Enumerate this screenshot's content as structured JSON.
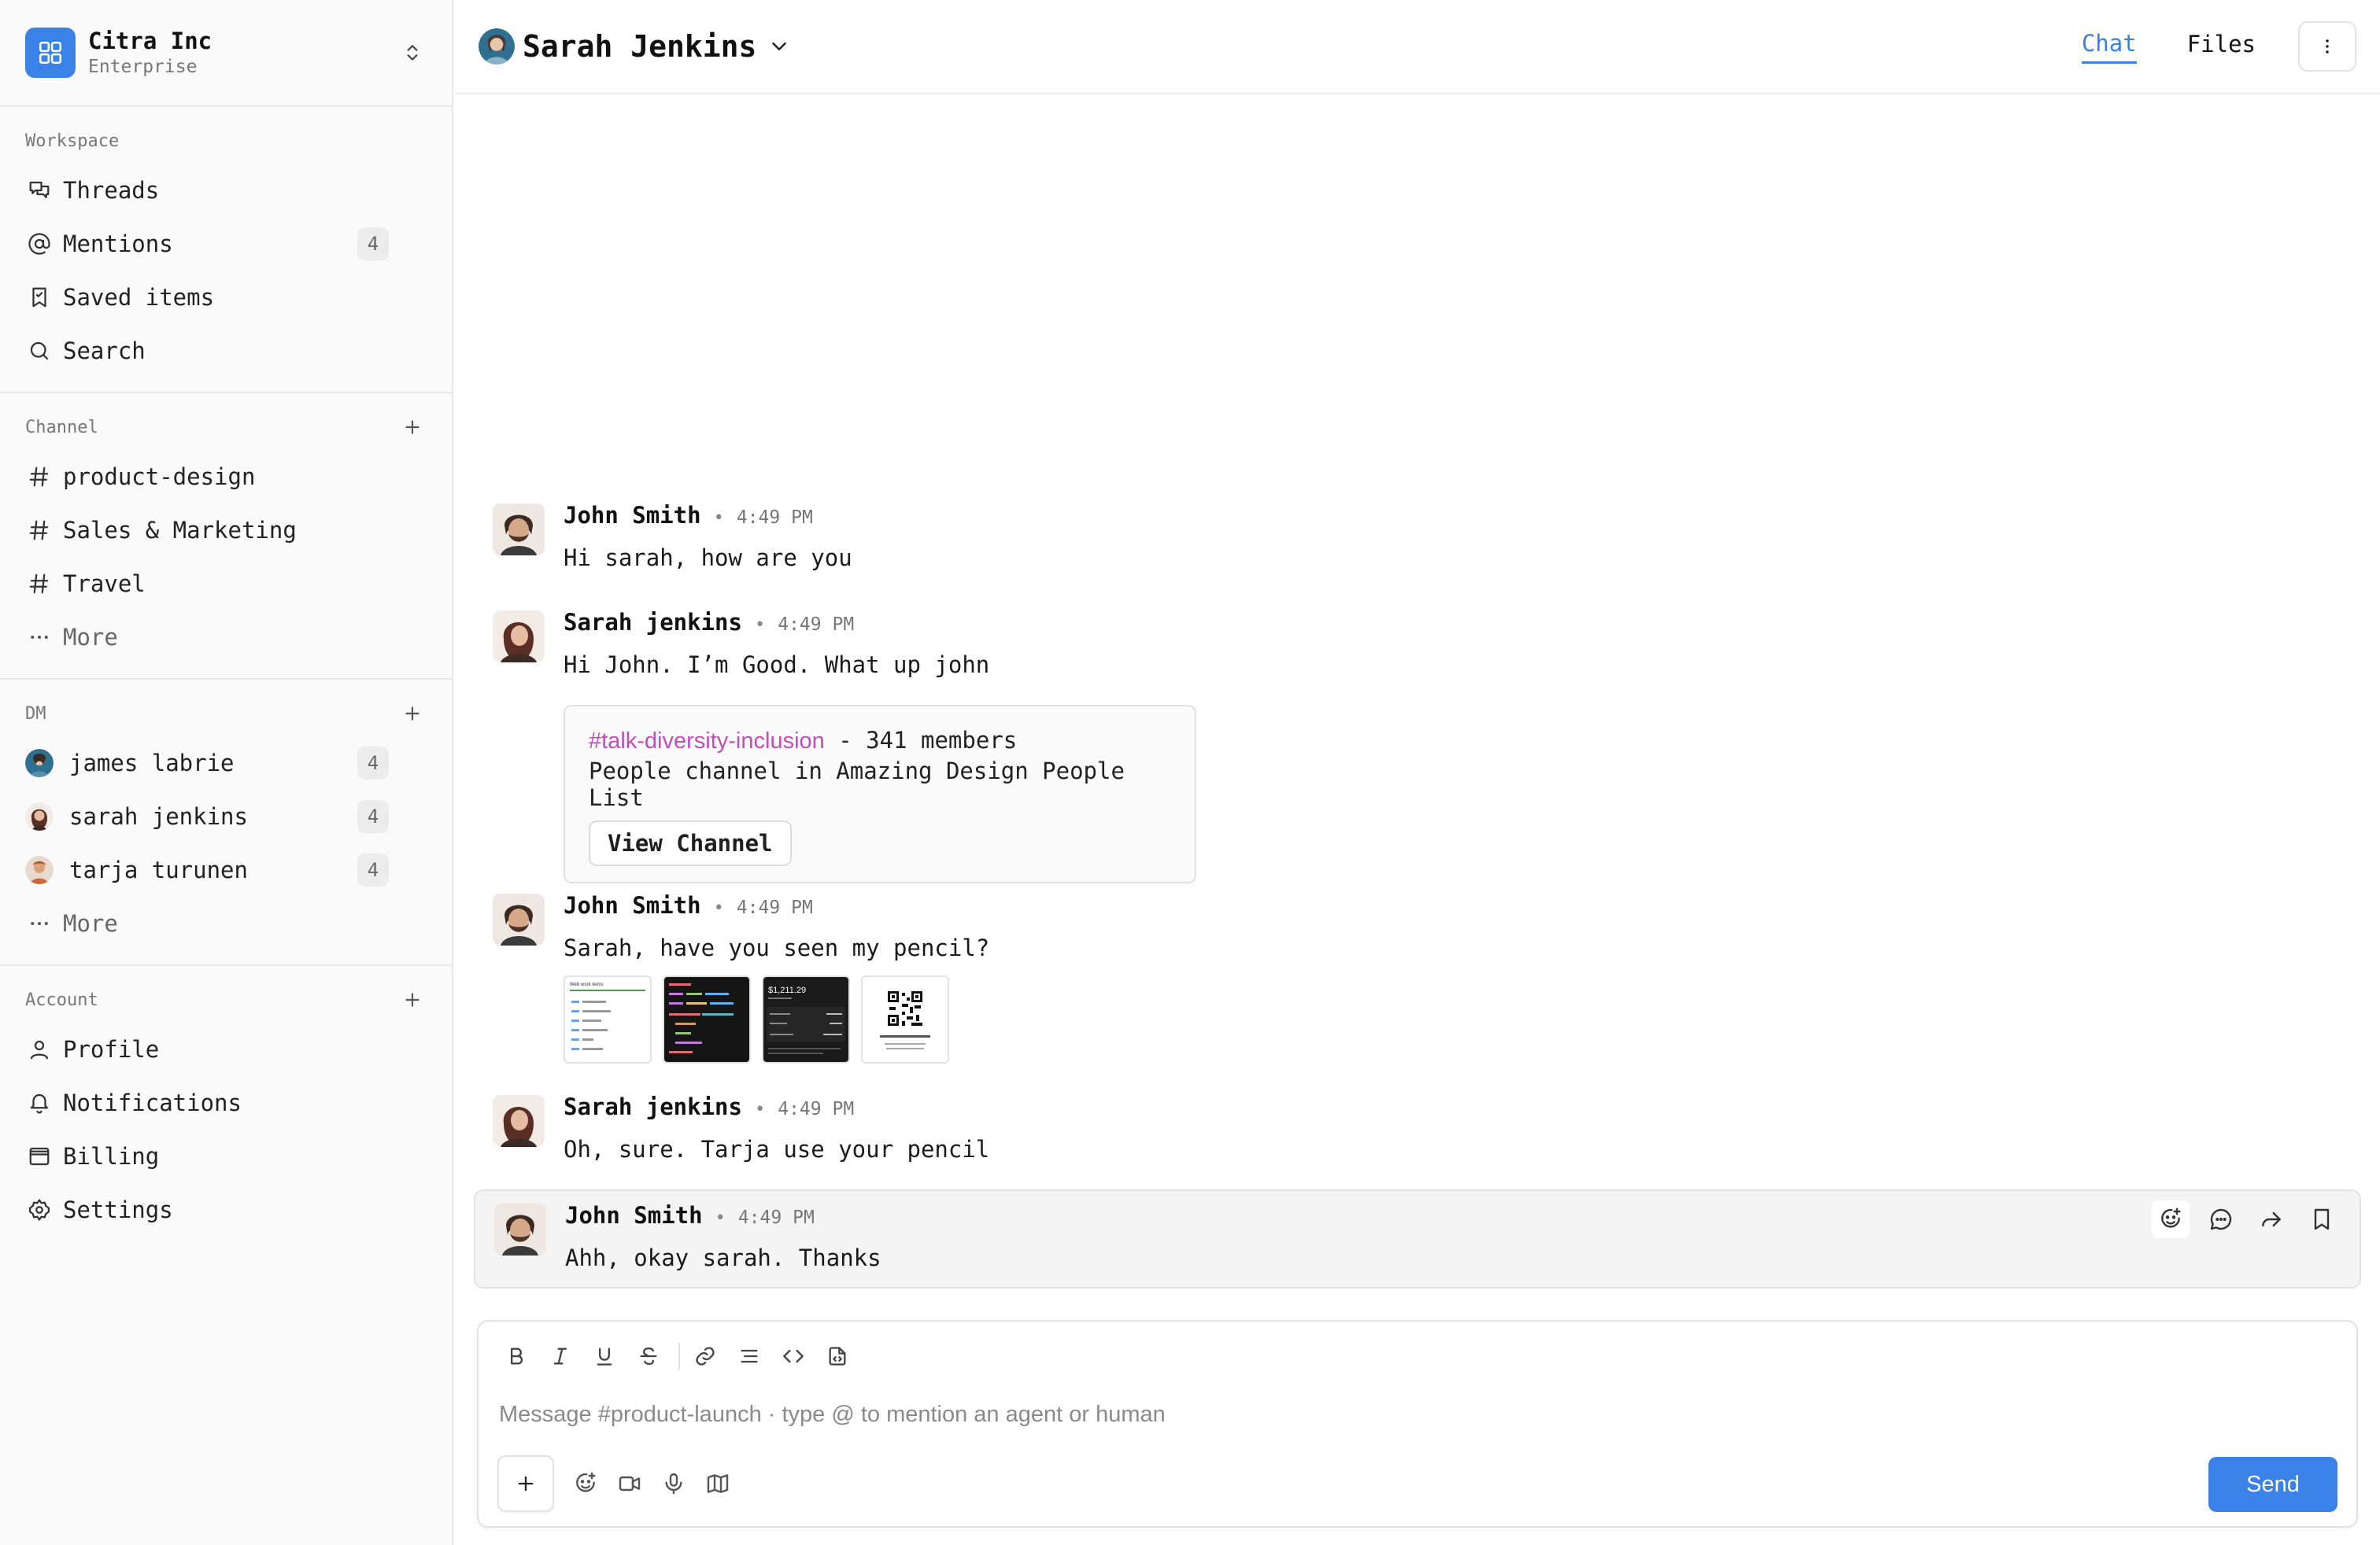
{
  "colors": {
    "accent": "#3b82e8",
    "channel_link": "#c04fb7"
  },
  "workspace": {
    "name": "Citra Inc",
    "plan": "Enterprise"
  },
  "sidebar": {
    "workspace_section": {
      "title": "Workspace",
      "items": [
        {
          "label": "Threads",
          "icon": "threads-icon"
        },
        {
          "label": "Mentions",
          "icon": "at-icon",
          "count": "4"
        },
        {
          "label": "Saved items",
          "icon": "bookmark-icon"
        },
        {
          "label": "Search",
          "icon": "search-icon"
        }
      ]
    },
    "channel_section": {
      "title": "Channel",
      "items": [
        {
          "label": "product-design"
        },
        {
          "label": "Sales & Marketing"
        },
        {
          "label": "Travel"
        }
      ],
      "more": "More"
    },
    "dm_section": {
      "title": "DM",
      "items": [
        {
          "label": "james labrie",
          "count": "4"
        },
        {
          "label": "sarah jenkins",
          "count": "4"
        },
        {
          "label": "tarja turunen",
          "count": "4"
        }
      ],
      "more": "More"
    },
    "account_section": {
      "title": "Account",
      "items": [
        {
          "label": "Profile",
          "icon": "user-icon"
        },
        {
          "label": "Notifications",
          "icon": "bell-icon"
        },
        {
          "label": "Billing",
          "icon": "billing-icon"
        },
        {
          "label": "Settings",
          "icon": "gear-icon"
        }
      ]
    }
  },
  "header": {
    "contact_name": "Sarah Jenkins",
    "tabs": {
      "chat": "Chat",
      "files": "Files"
    }
  },
  "messages": [
    {
      "author": "John Smith",
      "time": "4:49 PM",
      "text": "Hi sarah, how are you"
    },
    {
      "author": "Sarah jenkins",
      "time": "4:49 PM",
      "text": "Hi John. I’m Good. What up john",
      "card": {
        "channel": "#talk-diversity-inclusion",
        "members": "- 341 members",
        "description": "People channel in Amazing Design People List",
        "button": "View Channel"
      }
    },
    {
      "author": "John Smith",
      "time": "4:49 PM",
      "text": "Sarah, have you seen my pencil?",
      "attachments": [
        {
          "title": "Web work items",
          "kind": "list-screenshot"
        },
        {
          "kind": "code-screenshot"
        },
        {
          "value": "$1,211.29",
          "kind": "dashboard-screenshot"
        },
        {
          "kind": "qr-code"
        }
      ]
    },
    {
      "author": "Sarah jenkins",
      "time": "4:49 PM",
      "text": "Oh, sure. Tarja use your pencil"
    },
    {
      "author": "John Smith",
      "time": "4:49 PM",
      "text": "Ahh, okay sarah. Thanks"
    }
  ],
  "composer": {
    "placeholder": "Message #product-launch · type @ to mention an agent or human",
    "send_label": "Send"
  }
}
